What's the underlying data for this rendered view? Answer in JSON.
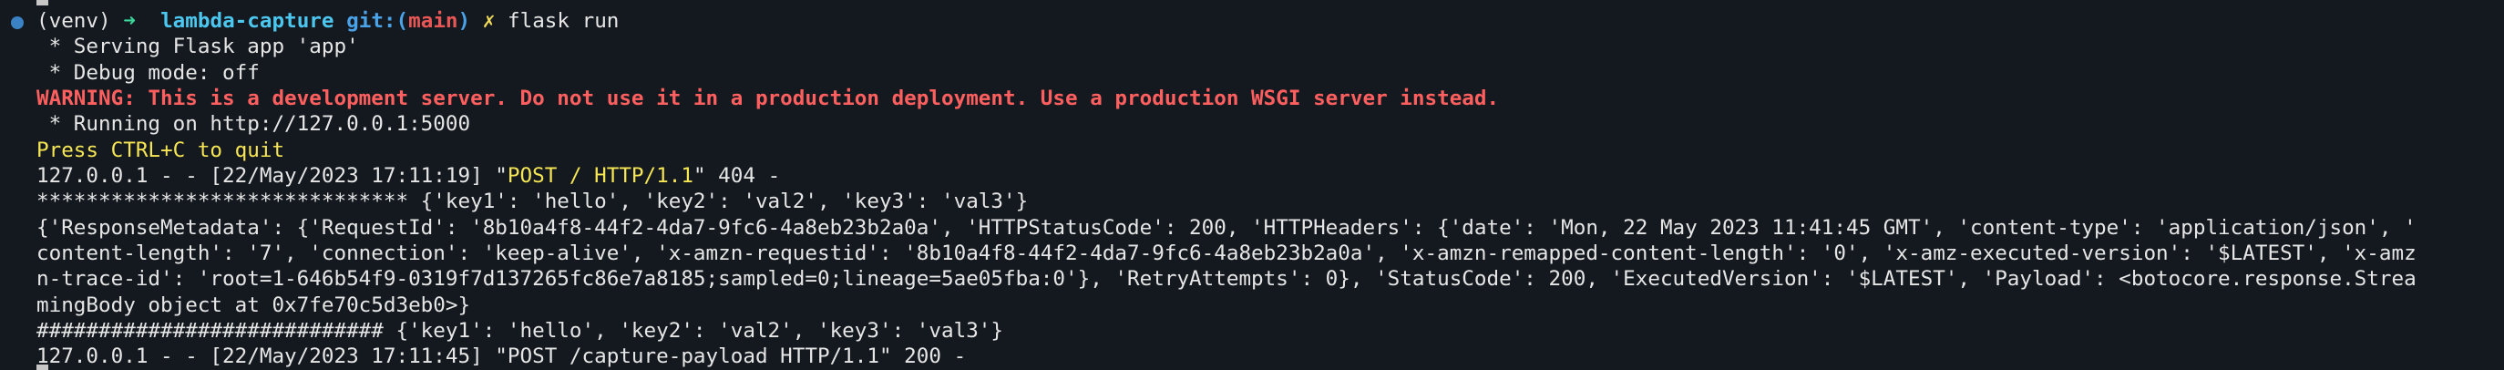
{
  "prompt": {
    "venv": "(venv)",
    "arrow": "➜",
    "directory": "lambda-capture",
    "git_label": "git:(",
    "branch": "main",
    "git_close": ")",
    "x_mark": "✗",
    "command": "flask run"
  },
  "output": {
    "serving": " * Serving Flask app 'app'",
    "debug": " * Debug mode: off",
    "warning": "WARNING: This is a development server. Do not use it in a production deployment. Use a production WSGI server instead.",
    "running": " * Running on http://127.0.0.1:5000",
    "quit": "Press CTRL+C to quit",
    "log1_prefix": "127.0.0.1 - - [22/May/2023 17:11:19] \"",
    "log1_request": "POST / HTTP/1.1",
    "log1_suffix": "\" 404 -",
    "stars_line": "****************************** {'key1': 'hello', 'key2': 'val2', 'key3': 'val3'}",
    "response_1": "{'ResponseMetadata': {'RequestId': '8b10a4f8-44f2-4da7-9fc6-4a8eb23b2a0a', 'HTTPStatusCode': 200, 'HTTPHeaders': {'date': 'Mon, 22 May 2023 11:41:45 GMT', 'content-type': 'application/json', '",
    "response_2": "content-length': '7', 'connection': 'keep-alive', 'x-amzn-requestid': '8b10a4f8-44f2-4da7-9fc6-4a8eb23b2a0a', 'x-amzn-remapped-content-length': '0', 'x-amz-executed-version': '$LATEST', 'x-amz",
    "response_3": "n-trace-id': 'root=1-646b54f9-0319f7d137265fc86e7a8185;sampled=0;lineage=5ae05fba:0'}, 'RetryAttempts': 0}, 'StatusCode': 200, 'ExecutedVersion': '$LATEST', 'Payload': <botocore.response.Strea",
    "response_4": "mingBody object at 0x7fe70c5d3eb0>}",
    "hash_line": "############################ {'key1': 'hello', 'key2': 'val2', 'key3': 'val3'}",
    "log2": "127.0.0.1 - - [22/May/2023 17:11:45] \"POST /capture-payload HTTP/1.1\" 200 -"
  },
  "colors": {
    "background": "#14191f",
    "warning": "#ff5f5f",
    "highlight": "#f7e654",
    "directory": "#4cc7f0",
    "branch": "#e85656"
  }
}
